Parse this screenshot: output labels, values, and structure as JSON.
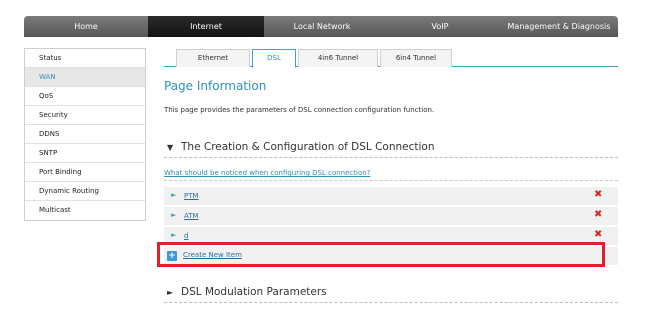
{
  "topnav": {
    "items": [
      {
        "label": "Home"
      },
      {
        "label": "Internet"
      },
      {
        "label": "Local Network"
      },
      {
        "label": "VoIP"
      },
      {
        "label": "Management & Diagnosis"
      }
    ],
    "active": "Internet"
  },
  "sidebar": {
    "items": [
      {
        "label": "Status"
      },
      {
        "label": "WAN"
      },
      {
        "label": "QoS"
      },
      {
        "label": "Security"
      },
      {
        "label": "DDNS"
      },
      {
        "label": "SNTP"
      },
      {
        "label": "Port Binding"
      },
      {
        "label": "Dynamic Routing"
      },
      {
        "label": "Multicast"
      }
    ],
    "active": "WAN"
  },
  "tabs": {
    "items": [
      {
        "label": "Ethernet"
      },
      {
        "label": "DSL"
      },
      {
        "label": "4in6 Tunnel"
      },
      {
        "label": "6in4 Tunnel"
      }
    ],
    "active": "DSL"
  },
  "page": {
    "title": "Page Information",
    "description": "This page provides the parameters of DSL connection configuration function."
  },
  "dsl_section": {
    "title": "The Creation & Configuration of DSL Connection",
    "help_link": "What should be noticed when configuring DSL connection?",
    "connections": [
      {
        "name": "PTM"
      },
      {
        "name": "ATM"
      },
      {
        "name": "d"
      }
    ],
    "create_label": "Create New Item"
  },
  "modulation_section": {
    "title": "DSL Modulation Parameters"
  },
  "colors": {
    "accent": "#2f8fb7",
    "delete": "#d0302a",
    "highlight": "#e3202a"
  },
  "icons": {
    "expanded": "▼",
    "collapsed": "►",
    "row": "►",
    "delete": "✖",
    "add": "+"
  }
}
